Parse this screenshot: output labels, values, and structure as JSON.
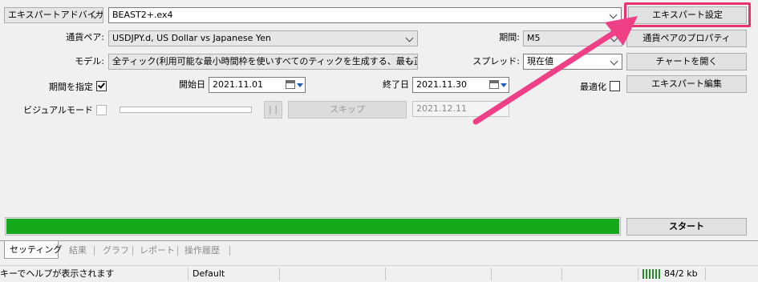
{
  "tester": {
    "type_select": "エキスパートアドバイザ",
    "expert_file": "BEAST2+.ex4",
    "expert_settings_button": "エキスパート設定",
    "symbol_label": "通貨ペア:",
    "symbol_value": "USDJPY.d, US Dollar vs Japanese Yen",
    "period_label": "期間:",
    "period_value": "M5",
    "symbol_properties_button": "通貨ペアのプロパティ",
    "model_label": "モデル:",
    "model_value": "全ティック(利用可能な最小時間枠を使いすべてのティックを生成する、最も正確)",
    "spread_label": "スプレッド:",
    "spread_value": "現在値",
    "open_chart_button": "チャートを開く",
    "use_date_label": "期間を指定",
    "use_date_checked": true,
    "from_label": "開始日",
    "from_date": "2021.11.01",
    "to_label": "終了日",
    "to_date": "2021.11.30",
    "optimization_label": "最適化",
    "optimization_checked": false,
    "modify_expert_button": "エキスパート編集",
    "visual_mode_label": "ビジュアルモード",
    "visual_mode_checked": false,
    "pause_button": "| |",
    "skip_button": "スキップ",
    "skip_date": "2021.12.11",
    "progress": 1.0,
    "start_button": "スタート"
  },
  "tabs": [
    "セッティング",
    "結果",
    "グラフ",
    "レポート",
    "操作履歴"
  ],
  "statusbar": {
    "help_text": "キーでヘルプが表示されます",
    "profile": "Default",
    "traffic": "84/2 kb"
  },
  "colors": {
    "progress_fill": "#17a91c",
    "arrow": "#ef3f86",
    "highlight_border": "#e8336e"
  }
}
